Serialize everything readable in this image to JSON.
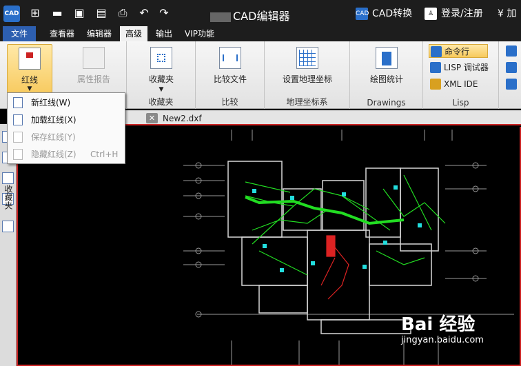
{
  "titlebar": {
    "app_title": "CAD编辑器",
    "logo_text": "CAD",
    "convert_label": "CAD转换",
    "login_label": "登录/注册",
    "extra_label": "¥ 加"
  },
  "menu": {
    "file": "文件",
    "viewer": "查看器",
    "editor": "编辑器",
    "advanced": "高级",
    "output": "输出",
    "vip": "VIP功能"
  },
  "ribbon": {
    "redline": "红线",
    "property_report": "属性报告",
    "favorites_btn": "收藏夹",
    "favorites_group": "收藏夹",
    "compare_btn": "比较文件",
    "compare_group": "比较",
    "geo_btn": "设置地理坐标",
    "geo_group": "地理坐标系",
    "stats_btn": "绘图统计",
    "drawings_group": "Drawings",
    "cmdline": "命令行",
    "lisp_debugger": "LISP 调试器",
    "xml_ide": "XML IDE",
    "lisp_group": "Lisp"
  },
  "dropdown": {
    "new_redline": "新红线(W)",
    "load_redline": "加载红线(X)",
    "save_redline": "保存红线(Y)",
    "hide_redline": "隐藏红线(Z)",
    "hide_shortcut": "Ctrl+H"
  },
  "tabs": {
    "doc_name": "New2.dxf",
    "close_glyph": "✕"
  },
  "sidebar": {
    "favorites_vertical": "收藏夹"
  },
  "watermark": {
    "brand": "Bai 经验",
    "url": "jingyan.baidu.com"
  },
  "colors": {
    "accent_blue": "#2a6fc9",
    "redline": "#cc2222",
    "cad_green": "#22dd22",
    "cad_cyan": "#22dddd"
  }
}
